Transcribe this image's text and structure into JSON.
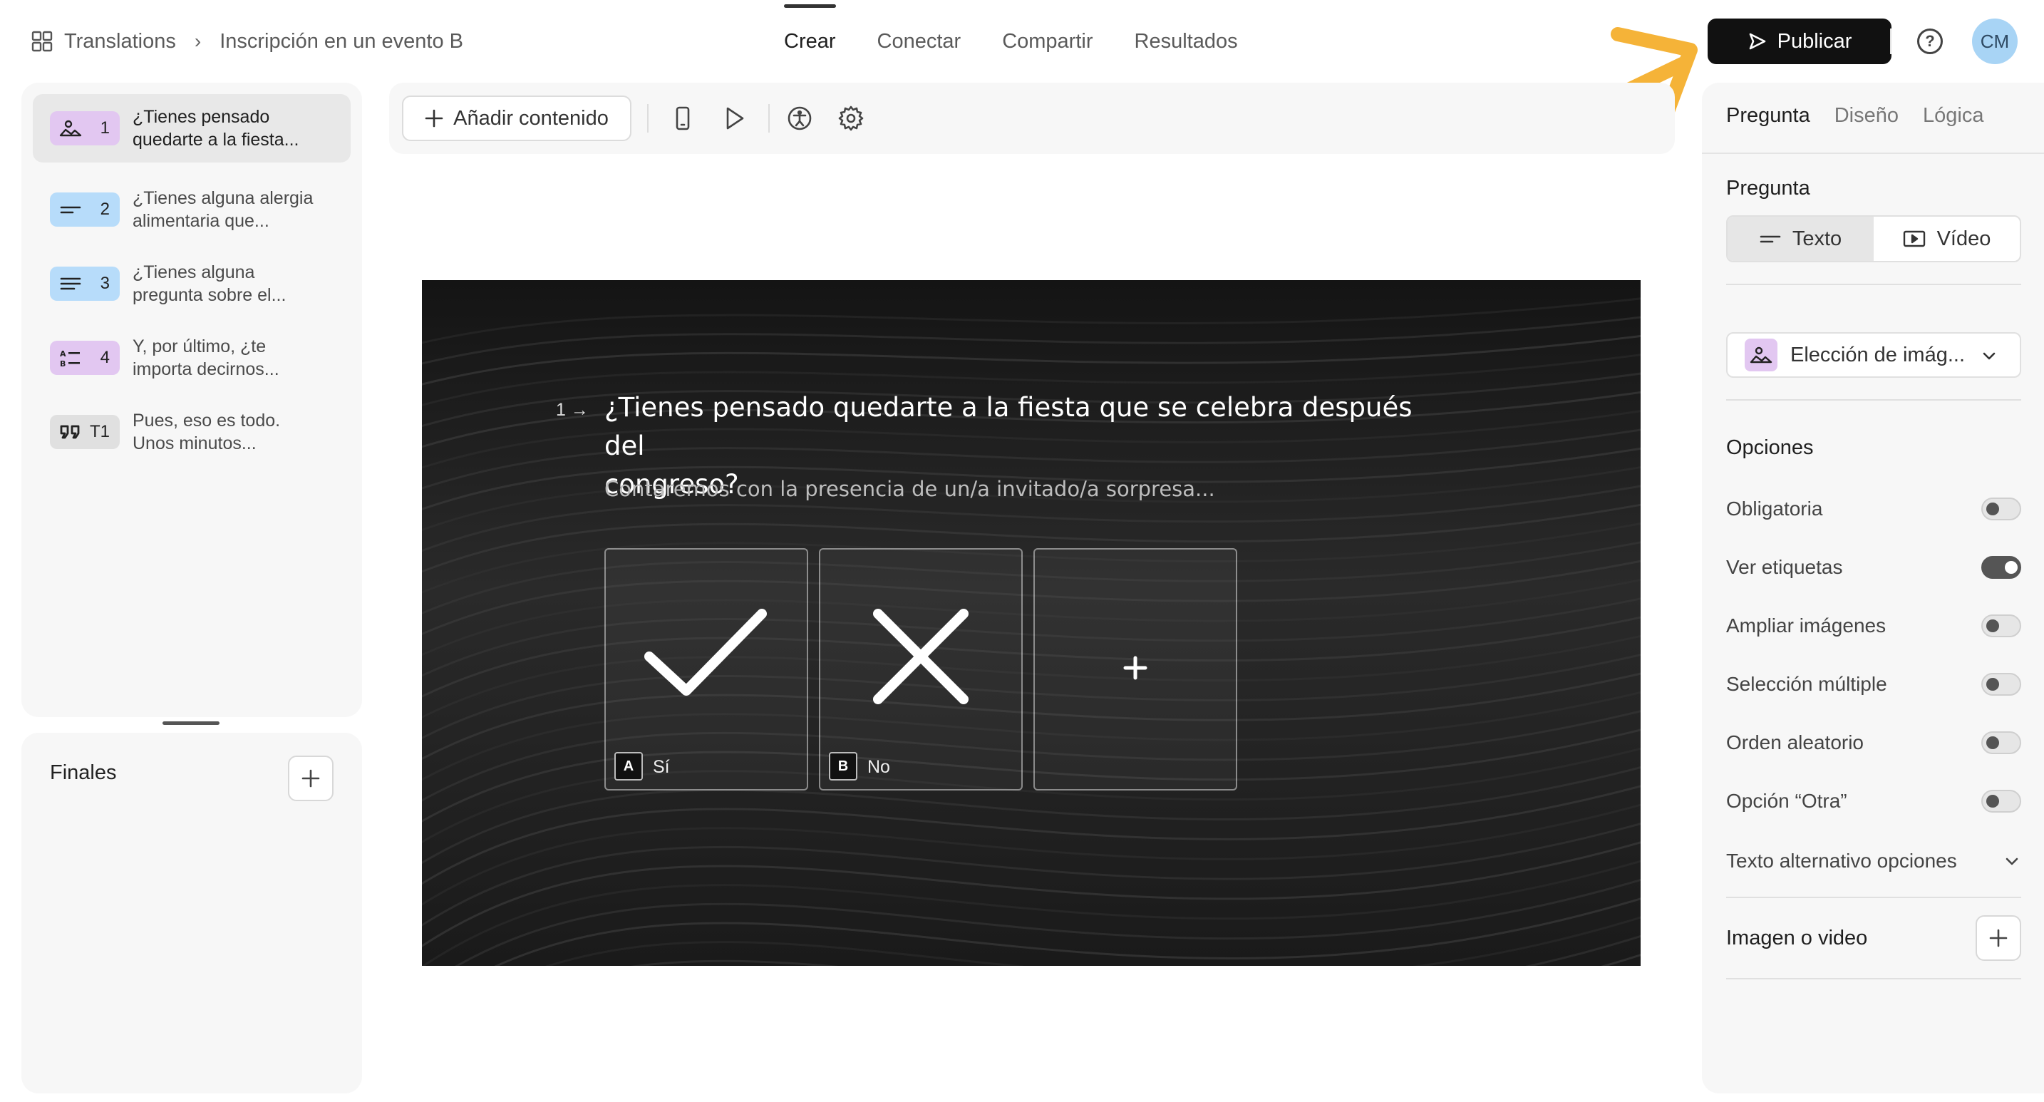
{
  "header": {
    "workspace": "Translations",
    "form_title": "Inscripción en un evento B",
    "tabs": [
      "Crear",
      "Conectar",
      "Compartir",
      "Resultados"
    ],
    "active_tab": "Crear",
    "publish_label": "Publicar",
    "avatar_initials": "CM"
  },
  "questions": [
    {
      "number": "1",
      "type_icon": "image-choice-icon",
      "text_line1": "¿Tienes pensado",
      "text_line2": "quedarte a la fiesta..."
    },
    {
      "number": "2",
      "type_icon": "short-text-icon",
      "text_line1": "¿Tienes alguna alergia",
      "text_line2": "alimentaria que..."
    },
    {
      "number": "3",
      "type_icon": "long-text-icon",
      "text_line1": "¿Tienes alguna",
      "text_line2": "pregunta sobre el..."
    },
    {
      "number": "4",
      "type_icon": "multiple-choice-icon",
      "text_line1": "Y, por último, ¿te",
      "text_line2": "importa decirnos..."
    },
    {
      "number": "T1",
      "type_icon": "quote-icon",
      "text_line1": "Pues, eso es todo.",
      "text_line2": "Unos minutos..."
    }
  ],
  "finales": {
    "label": "Finales"
  },
  "toolbar": {
    "add_content_label": "Añadir contenido"
  },
  "preview": {
    "question_number": "1",
    "title_line1": "¿Tienes pensado quedarte a la fiesta que se celebra después del",
    "title_line2": "congreso?",
    "description": "Contaremos con la presencia de un/a invitado/a sorpresa...",
    "choices": [
      {
        "key": "A",
        "label": "Sí",
        "icon": "check-icon"
      },
      {
        "key": "B",
        "label": "No",
        "icon": "cross-icon"
      }
    ]
  },
  "settings": {
    "tabs": [
      "Pregunta",
      "Diseño",
      "Lógica"
    ],
    "active_tab": "Pregunta",
    "section_question": "Pregunta",
    "format_text": "Texto",
    "format_video": "Vídeo",
    "question_type": "Elección de imág...",
    "options_title": "Opciones",
    "options": [
      {
        "label": "Obligatoria",
        "enabled": false
      },
      {
        "label": "Ver etiquetas",
        "enabled": true
      },
      {
        "label": "Ampliar imágenes",
        "enabled": false
      },
      {
        "label": "Selección múltiple",
        "enabled": false
      },
      {
        "label": "Orden aleatorio",
        "enabled": false
      },
      {
        "label": "Opción “Otra”",
        "enabled": false
      }
    ],
    "alt_text_label": "Texto alternativo opciones",
    "media_label": "Imagen o video"
  },
  "colors": {
    "accent_arrow": "#F5B338",
    "purple_badge": "#E2C7F1",
    "blue_badge": "#B7DCFA",
    "publish_bg": "#111111",
    "avatar_bg": "#A8D4F5"
  }
}
